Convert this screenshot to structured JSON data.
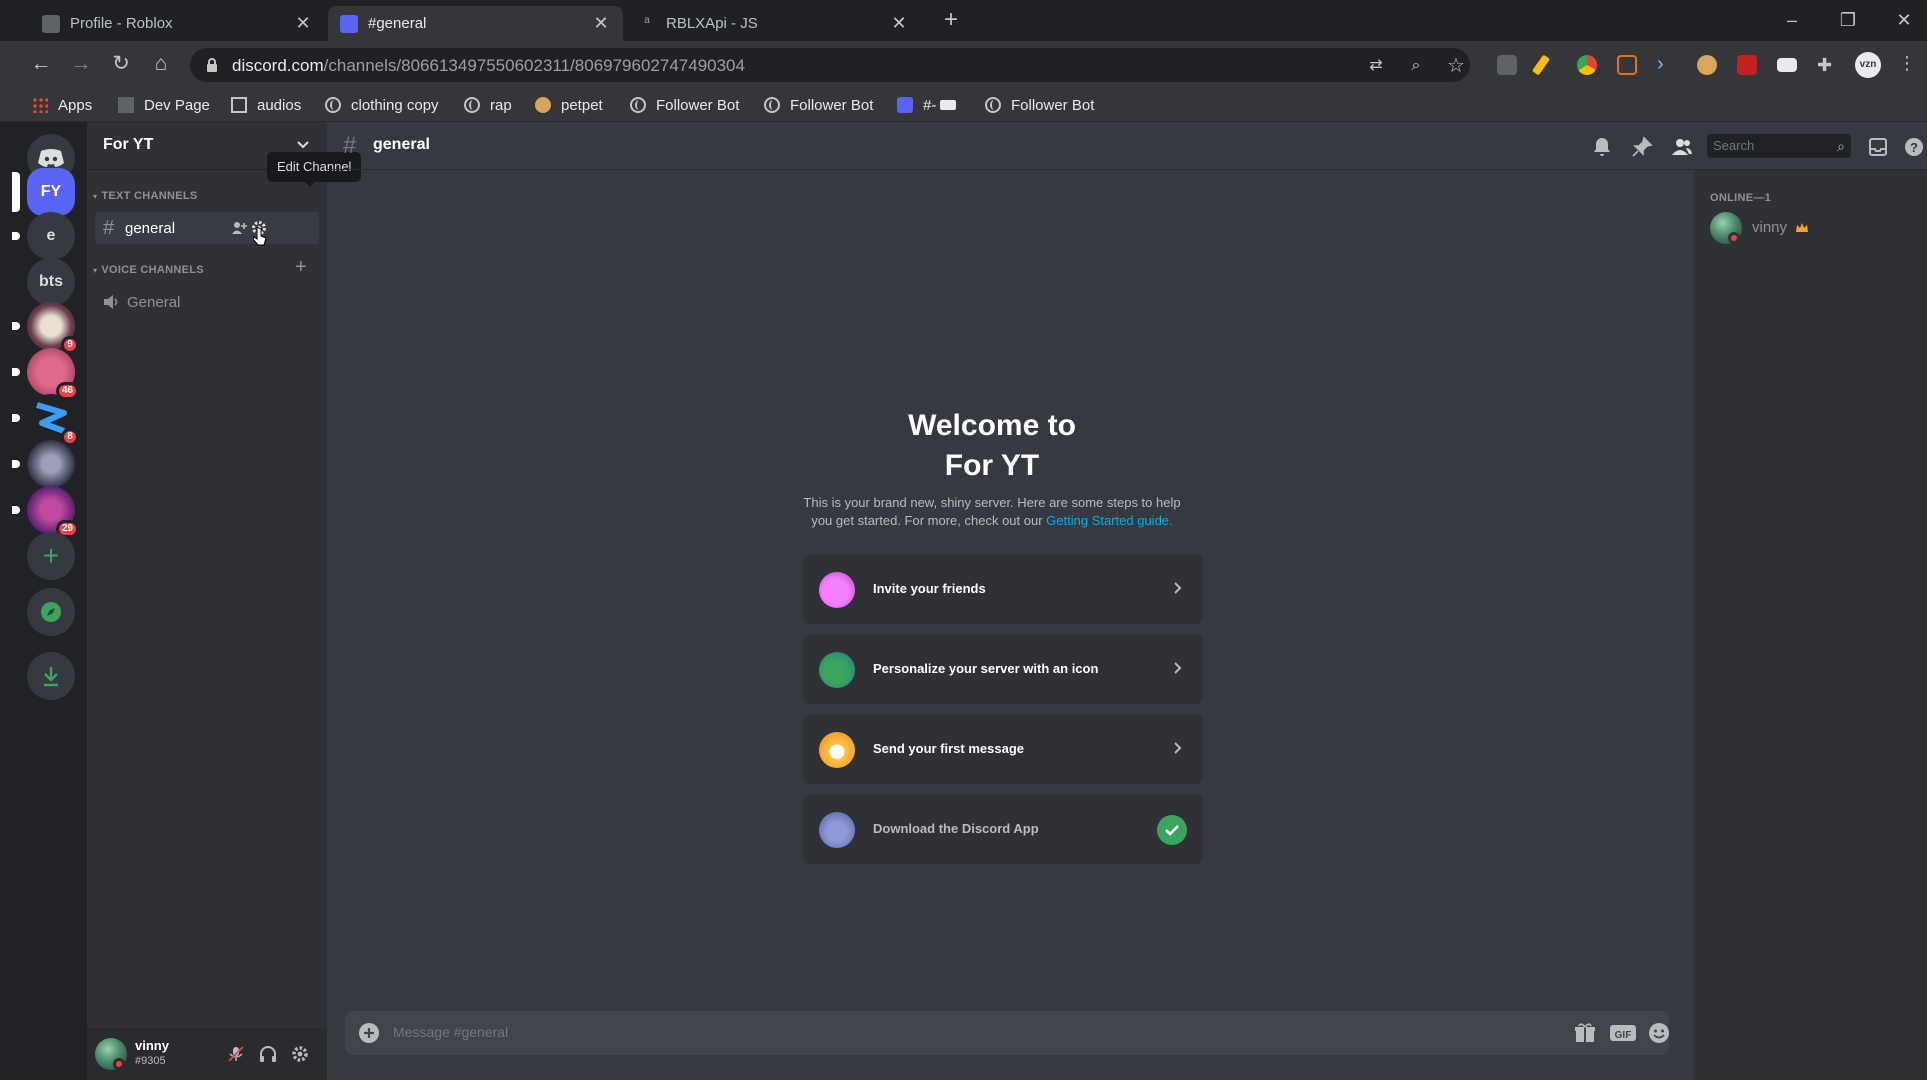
{
  "browser": {
    "tabs": [
      {
        "title": "Profile - Roblox",
        "active": false
      },
      {
        "title": "#general",
        "active": true
      },
      {
        "title": "RBLXApi - JS",
        "active": false
      }
    ],
    "url_domain": "discord.com",
    "url_path": "/channels/806613497550602311/806979602747490304",
    "bookmarks": [
      "Apps",
      "Dev Page",
      "audios",
      "clothing copy",
      "rap",
      "petpet",
      "Follower Bot",
      "Follower Bot",
      "#-",
      "Follower Bot"
    ],
    "profile_label": "vzn"
  },
  "discord": {
    "guilds": [
      {
        "label": "FY",
        "badge": ""
      },
      {
        "label": "e",
        "badge": ""
      },
      {
        "label": "bts",
        "badge": ""
      },
      {
        "label": "",
        "badge": "9"
      },
      {
        "label": "",
        "badge": "46"
      },
      {
        "label": "",
        "badge": "8"
      },
      {
        "label": "",
        "badge": ""
      },
      {
        "label": "",
        "badge": "29"
      }
    ],
    "server_name": "For YT",
    "text_category": "TEXT CHANNELS",
    "voice_category": "VOICE CHANNELS",
    "text_channel": "general",
    "voice_channel": "General",
    "tooltip": "Edit Channel",
    "channel_header": "general",
    "search_placeholder": "Search",
    "welcome_title_line1": "Welcome to",
    "welcome_title_line2": "For YT",
    "welcome_body_line1": "This is your brand new, shiny server. Here are some steps to help",
    "welcome_body_line2": "you get started. For more, check out our ",
    "welcome_link": "Getting Started guide.",
    "cards": [
      {
        "label": "Invite your friends",
        "done": false
      },
      {
        "label": "Personalize your server with an icon",
        "done": false
      },
      {
        "label": "Send your first message",
        "done": false
      },
      {
        "label": "Download the Discord App",
        "done": true
      }
    ],
    "composer_placeholder": "Message #general",
    "members_header": "ONLINE—1",
    "member_name": "vinny",
    "user_name": "vinny",
    "user_tag": "#9305",
    "colors": {
      "blurple": "#5865f2",
      "green": "#3ba55d",
      "red": "#ed4245",
      "link": "#00aff4"
    }
  }
}
